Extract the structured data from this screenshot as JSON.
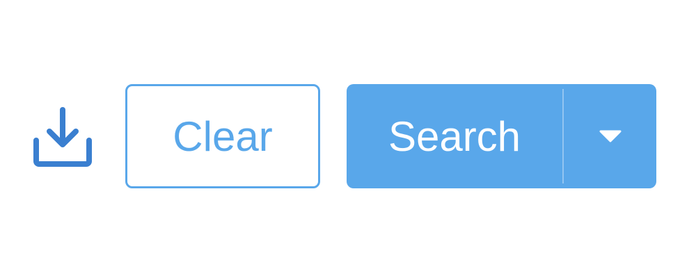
{
  "toolbar": {
    "download_icon": "download-tray-icon",
    "clear_label": "Clear",
    "search_label": "Search",
    "dropdown_icon": "caret-down-icon"
  },
  "colors": {
    "accent": "#59a7ea",
    "icon": "#3a7fd0",
    "button_text_on_accent": "#ffffff",
    "background": "#ffffff"
  }
}
